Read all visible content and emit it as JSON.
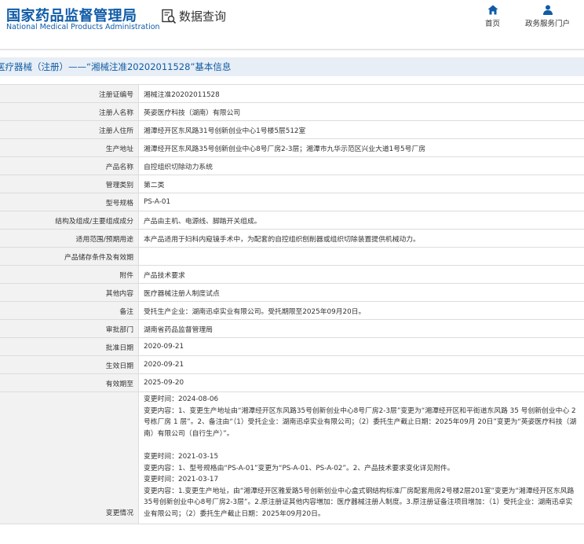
{
  "header": {
    "logo_cn": "国家药品监督管理局",
    "logo_en": "National Medical Products Administration",
    "section": "数据查询",
    "nav": [
      {
        "label": "首页",
        "icon": "home-icon"
      },
      {
        "label": "政务服务门户",
        "icon": "user-icon"
      }
    ],
    "brand_color": "#0f5ba8"
  },
  "page_title": "医疗器械（注册）——“湘械注准20202011528”基本信息",
  "rows": [
    {
      "label": "注册证编号",
      "value": "湘械注准20202011528"
    },
    {
      "label": "注册人名称",
      "value": "英姿医疗科技（湖南）有限公司"
    },
    {
      "label": "注册人住所",
      "value": "湘潭经开区东风路31号创新创业中心1号楼5层512室"
    },
    {
      "label": "生产地址",
      "value": "湘潭经开区东风路35号创新创业中心8号厂房2-3层；湘潭市九华示范区兴业大道1号5号厂房"
    },
    {
      "label": "产品名称",
      "value": "自控组织切除动力系统"
    },
    {
      "label": "管理类别",
      "value": "第二类"
    },
    {
      "label": "型号规格",
      "value": "PS-A-01"
    },
    {
      "label": "结构及组成/主要组成成分",
      "value": "产品由主机、电源线、脚踏开关组成。"
    },
    {
      "label": "适用范围/预期用途",
      "value": "本产品适用于妇科内窥镜手术中，为配套的自控组织刨削器或组织切除装置提供机械动力。"
    },
    {
      "label": "产品储存条件及有效期",
      "value": ""
    },
    {
      "label": "附件",
      "value": "产品技术要求"
    },
    {
      "label": "其他内容",
      "value": "医疗器械注册人制度试点"
    },
    {
      "label": "备注",
      "value": "受托生产企业：湖南迅卓实业有限公司。受托期限至2025年09月20日。"
    },
    {
      "label": "审批部门",
      "value": "湖南省药品监督管理局"
    },
    {
      "label": "批准日期",
      "value": "2020-09-21"
    },
    {
      "label": "生效日期",
      "value": "2020-09-21"
    },
    {
      "label": "有效期至",
      "value": "2025-09-20"
    }
  ],
  "changes": {
    "label": "变更情况",
    "blocks": [
      [
        "变更时间：2024-08-06",
        "变更内容：1、变更生产地址由“湘潭经开区东风路35号创新创业中心8号厂房2-3层”变更为“湘潭经开区和平街道东风路 35 号创新创业中心 2 号栋厂房 1 层”。2、备注由“（1）受托企业：湖南迅卓实业有限公司；（2）委托生产截止日期：2025年09月 20日”变更为“英姿医疗科技（湖南）有限公司（自行生产）”。"
      ],
      [
        "变更时间：2021-03-15",
        "变更内容：1、型号规格由“PS-A-01”变更为“PS-A-01、PS-A-02”。2、产品技术要求变化详见附件。",
        "变更时间：2021-03-17",
        "变更内容：1.变更生产地址，由“湘潭经开区雅爱路5号创新创业中心盒式钢结构标准厂房配套用房2号楼2层201室”变更为“湘潭经开区东风路35号创新创业中心8号厂房2-3层”。2.原注册证其他内容増加：医疗器械注册人制度。3.原注册证备注项目增加：（1）受托企业：湖南迅卓实业有限公司；（2）委托生产截止日期：2025年09月20日。"
      ]
    ]
  }
}
